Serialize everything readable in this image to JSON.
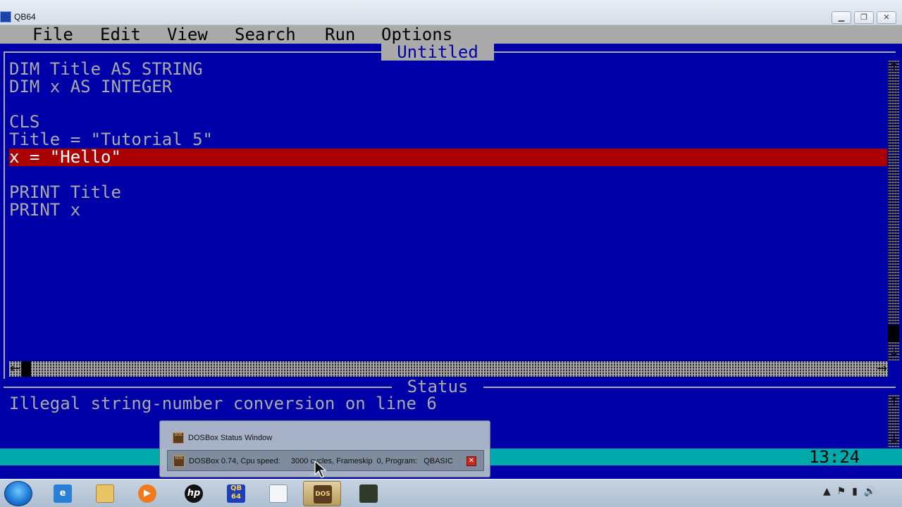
{
  "window": {
    "title": "QB64"
  },
  "menu": {
    "items": [
      {
        "label": "File"
      },
      {
        "label": "Edit"
      },
      {
        "label": "View"
      },
      {
        "label": "Search"
      },
      {
        "label": "Run"
      },
      {
        "label": "Options"
      }
    ]
  },
  "editor": {
    "title": "Untitled",
    "lines": [
      "DIM Title AS STRING",
      "DIM x AS INTEGER",
      "",
      "CLS",
      "Title = \"Tutorial 5\"",
      "x = \"Hello\"",
      "",
      "PRINT Title",
      "PRINT x"
    ],
    "error_line_index": 5
  },
  "status": {
    "title": "Status",
    "message": "Illegal string-number conversion on line 6"
  },
  "statusline": {
    "clock": "13:24"
  },
  "taskbar": {
    "popup": {
      "items": [
        {
          "label": "DOSBox Status Window"
        },
        {
          "label": "DOSBox 0.74, Cpu speed:     3000 cycles, Frameskip  0, Program:   QBASIC"
        }
      ]
    },
    "apps": [
      "Internet Explorer",
      "Libraries",
      "Media Player",
      "HP",
      "QB64",
      "Document",
      "DOSBox",
      "Tool"
    ]
  },
  "colors": {
    "editor_bg": "#0000a8",
    "editor_fg": "#aaaaaa",
    "error_bg": "#aa0000",
    "statusline_bg": "#00aaaa"
  }
}
